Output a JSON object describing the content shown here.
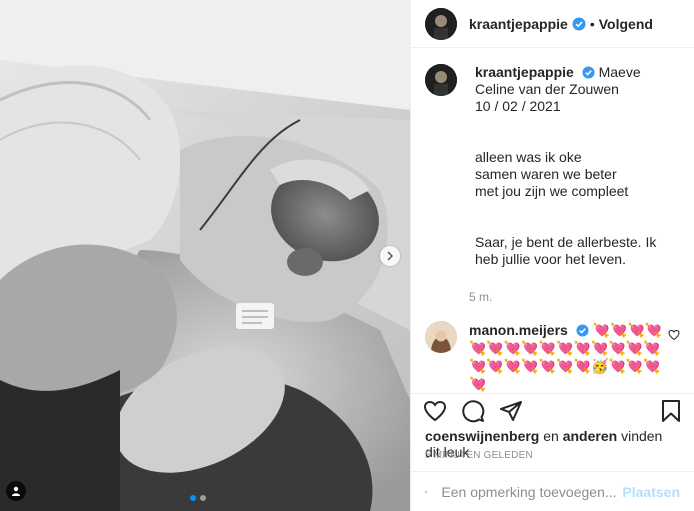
{
  "post": {
    "username": "kraantjepappie",
    "follow_label": "Volgend",
    "separator": "•",
    "caption": {
      "name_text": "Maeve Celine van der Zouwen",
      "date_line": "10 / 02 / 2021",
      "poem": [
        "alleen was ik oke",
        "samen waren we beter",
        "met jou zijn we compleet"
      ],
      "closing": "Saar, je bent de allerbeste. Ik heb jullie voor het leven."
    },
    "time_ago": "5 m."
  },
  "comment": {
    "username": "manon.meijers",
    "text": "💘💘💘💘💘💘💘💘💘💘💘💘💘💘💘💘💘💘💘💘💘💘🥳💘💘💘💘"
  },
  "likes": {
    "user": "coenswijnenberg",
    "and": "en",
    "others": "anderen",
    "suffix": "vinden dit leuk"
  },
  "timestamp": "5 MINUTEN GELEDEN",
  "composer": {
    "placeholder": "Een opmerking toevoegen...",
    "post_label": "Plaatsen"
  },
  "carousel": {
    "total": 2,
    "current": 1
  },
  "colors": {
    "accent": "#0095f6",
    "verified": "#3897f0",
    "muted": "#8e8e8e",
    "post_disabled": "#b2dffc"
  },
  "icons": [
    "verified-badge-icon",
    "heart-icon",
    "comment-icon",
    "share-icon",
    "bookmark-icon",
    "emoji-icon",
    "chevron-right-icon",
    "user-tag-icon"
  ]
}
